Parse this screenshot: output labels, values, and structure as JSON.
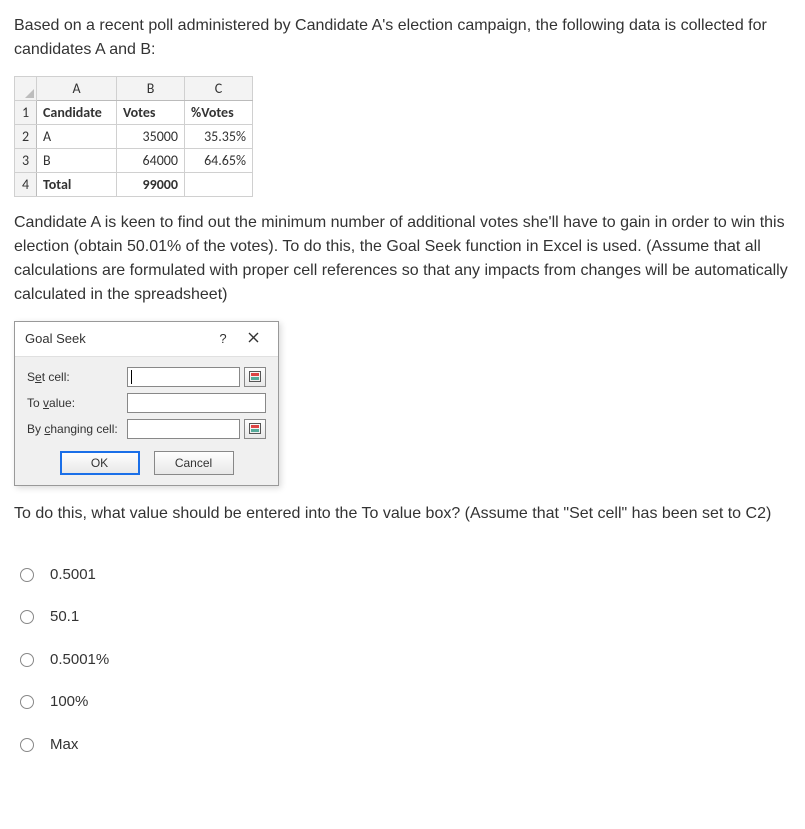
{
  "question": {
    "intro": "Based on a recent poll administered by Candidate A's election campaign, the following data is collected for candidates A and B:",
    "middle": "Candidate A is keen to find out the minimum number of additional votes she'll have to gain in order to win this election (obtain 50.01% of the votes). To do this, the Goal Seek function in Excel is used. (Assume that all calculations are formulated with proper cell references so that any impacts from changes will be automatically calculated in the spreadsheet)",
    "prompt": "To do this, what value should be entered into the To value box? (Assume that \"Set cell\" has been set to C2)"
  },
  "excel": {
    "cols": [
      "A",
      "B",
      "C"
    ],
    "rows": [
      "1",
      "2",
      "3",
      "4"
    ],
    "headers": {
      "A1": "Candidate",
      "B1": "Votes",
      "C1": "%Votes"
    },
    "data": [
      {
        "cand": "A",
        "votes": "35000",
        "pct": "35.35%"
      },
      {
        "cand": "B",
        "votes": "64000",
        "pct": "64.65%"
      },
      {
        "cand": "Total",
        "votes": "99000",
        "pct": ""
      }
    ]
  },
  "dialog": {
    "title": "Goal Seek",
    "help": "?",
    "close": "×",
    "set_cell_label": "Set cell:",
    "to_value_label": "To value:",
    "by_changing_label": "By changing cell:",
    "ok": "OK",
    "cancel": "Cancel"
  },
  "options": [
    "0.5001",
    "50.1",
    "0.5001%",
    "100%",
    "Max"
  ]
}
